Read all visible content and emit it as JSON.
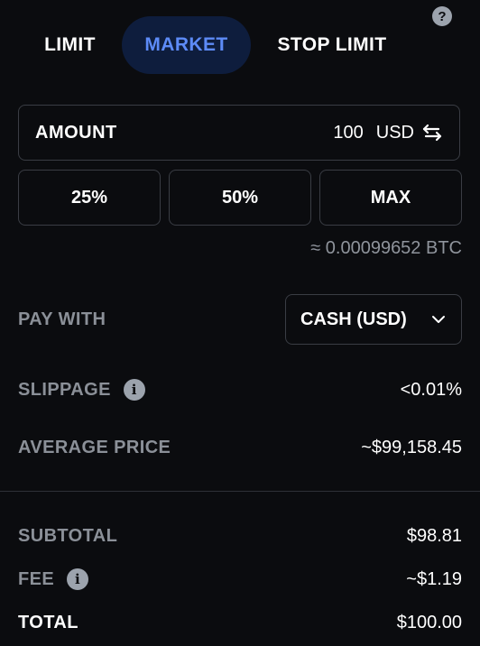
{
  "tabs": [
    {
      "label": "LIMIT"
    },
    {
      "label": "MARKET"
    },
    {
      "label": "STOP LIMIT"
    }
  ],
  "help_icon": "?",
  "amount": {
    "label": "AMOUNT",
    "value": "100",
    "currency": "USD",
    "swap_icon": "swap-arrows-icon"
  },
  "quick_amounts": [
    "25%",
    "50%",
    "MAX"
  ],
  "btc_estimate": "≈ 0.00099652 BTC",
  "pay_with": {
    "label": "PAY WITH",
    "selected": "CASH (USD)"
  },
  "slippage": {
    "label": "SLIPPAGE",
    "value": "<0.01%"
  },
  "average_price": {
    "label": "AVERAGE PRICE",
    "value": "~$99,158.45"
  },
  "summary": {
    "subtotal_label": "SUBTOTAL",
    "subtotal_value": "$98.81",
    "fee_label": "FEE",
    "fee_value": "~$1.19",
    "total_label": "TOTAL",
    "total_value": "$100.00"
  },
  "colors": {
    "background": "#0b0c0f",
    "accent": "#5d8bf7",
    "active_tab_bg": "#0e1d3d",
    "muted_text": "#8b9098",
    "border": "#3a3d44"
  }
}
